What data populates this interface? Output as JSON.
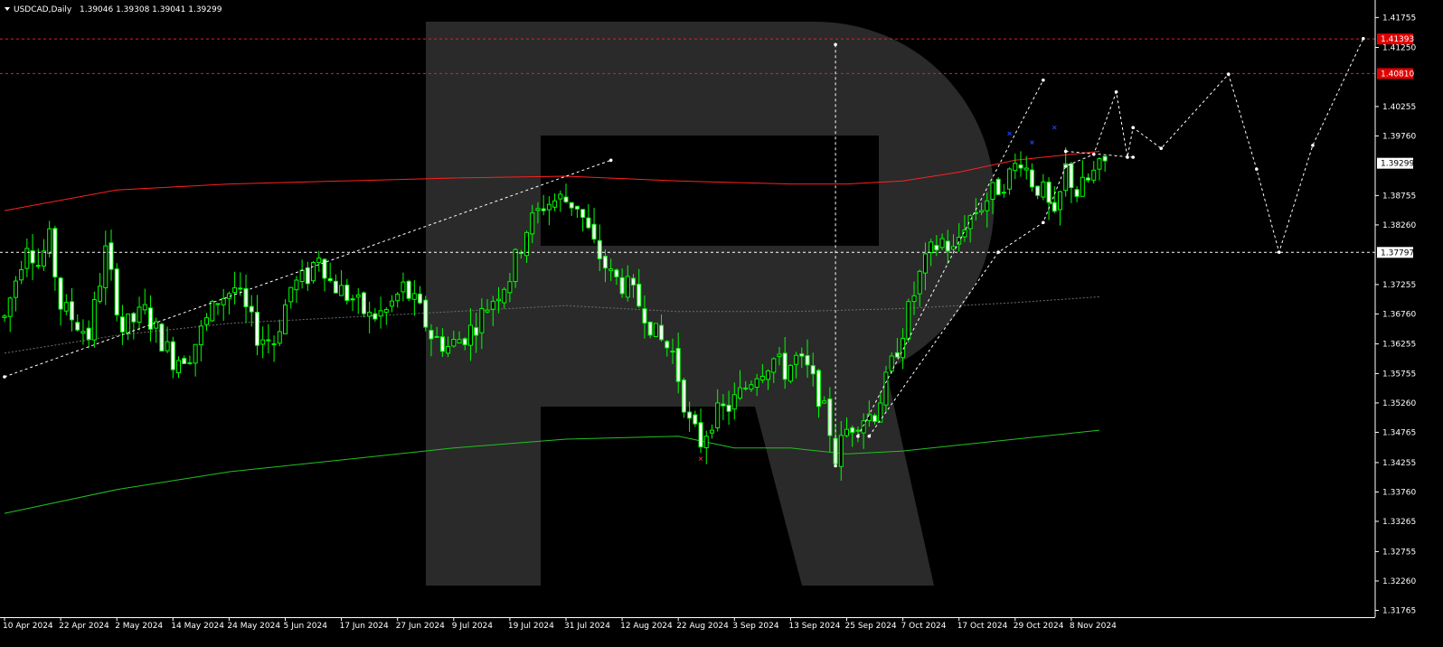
{
  "window": {
    "menu_icon": "triangle-down-icon",
    "symbol": "USDCAD,Daily",
    "ohlc": "1.39046 1.39308 1.39041 1.39299"
  },
  "colors": {
    "background": "#000000",
    "candle_up": "#00ff00",
    "candle_up_fill": "#000000",
    "candle_down": "#00ff00",
    "candle_down_fill": "#ffffff",
    "ma_red": "#ff2020",
    "ma_green": "#22c022",
    "ma_dotted": "#6e6e6e",
    "projection": "#ffffff",
    "level_line": "#e02020",
    "level_badge": "#e00000",
    "watermark": "#2a2a2a",
    "axis": "#ffffff"
  },
  "chart_data": {
    "type": "candlestick",
    "instrument": "USDCAD",
    "timeframe": "Daily",
    "ylim": [
      1.3165,
      1.4205
    ],
    "y_ticks": [
      "1.41755",
      "1.41250",
      "1.40255",
      "1.39760",
      "1.38755",
      "1.38260",
      "1.37255",
      "1.36760",
      "1.36255",
      "1.35755",
      "1.35260",
      "1.34765",
      "1.34255",
      "1.33760",
      "1.33265",
      "1.32755",
      "1.32260",
      "1.31765"
    ],
    "x_ticks": [
      "10 Apr 2024",
      "22 Apr 2024",
      "2 May 2024",
      "14 May 2024",
      "24 May 2024",
      "5 Jun 2024",
      "17 Jun 2024",
      "27 Jun 2024",
      "9 Jul 2024",
      "19 Jul 2024",
      "31 Jul 2024",
      "12 Aug 2024",
      "22 Aug 2024",
      "3 Sep 2024",
      "13 Sep 2024",
      "25 Sep 2024",
      "7 Oct 2024",
      "17 Oct 2024",
      "29 Oct 2024",
      "8 Nov 2024"
    ],
    "x_tick_bar_index": [
      0,
      10,
      20,
      30,
      40,
      50,
      60,
      70,
      80,
      90,
      100,
      110,
      120,
      130,
      140,
      150,
      160,
      170,
      180,
      190
    ],
    "bar_count": 197,
    "close_anchors": [
      [
        0,
        1.367
      ],
      [
        4,
        1.38
      ],
      [
        6,
        1.376
      ],
      [
        8,
        1.38
      ],
      [
        10,
        1.369
      ],
      [
        13,
        1.366
      ],
      [
        15,
        1.364
      ],
      [
        18,
        1.378
      ],
      [
        21,
        1.365
      ],
      [
        25,
        1.368
      ],
      [
        30,
        1.36
      ],
      [
        33,
        1.361
      ],
      [
        38,
        1.37
      ],
      [
        41,
        1.372
      ],
      [
        45,
        1.364
      ],
      [
        48,
        1.363
      ],
      [
        51,
        1.372
      ],
      [
        54,
        1.374
      ],
      [
        56,
        1.378
      ],
      [
        58,
        1.373
      ],
      [
        62,
        1.37
      ],
      [
        65,
        1.367
      ],
      [
        68,
        1.368
      ],
      [
        71,
        1.372
      ],
      [
        74,
        1.368
      ],
      [
        76,
        1.364
      ],
      [
        79,
        1.362
      ],
      [
        82,
        1.364
      ],
      [
        84,
        1.366
      ],
      [
        86,
        1.369
      ],
      [
        90,
        1.374
      ],
      [
        93,
        1.382
      ],
      [
        96,
        1.386
      ],
      [
        99,
        1.387
      ],
      [
        102,
        1.386
      ],
      [
        105,
        1.379
      ],
      [
        108,
        1.374
      ],
      [
        111,
        1.372
      ],
      [
        114,
        1.368
      ],
      [
        116,
        1.364
      ],
      [
        119,
        1.361
      ],
      [
        122,
        1.349
      ],
      [
        124,
        1.346
      ],
      [
        126,
        1.35
      ],
      [
        129,
        1.352
      ],
      [
        131,
        1.354
      ],
      [
        134,
        1.358
      ],
      [
        137,
        1.36
      ],
      [
        139,
        1.358
      ],
      [
        141,
        1.36
      ],
      [
        143,
        1.358
      ],
      [
        145,
        1.354
      ],
      [
        147,
        1.348
      ],
      [
        148,
        1.3435
      ],
      [
        150,
        1.348
      ],
      [
        152,
        1.35
      ],
      [
        155,
        1.351
      ],
      [
        157,
        1.356
      ],
      [
        159,
        1.362
      ],
      [
        161,
        1.368
      ],
      [
        163,
        1.374
      ],
      [
        165,
        1.378
      ],
      [
        167,
        1.38
      ],
      [
        169,
        1.378
      ],
      [
        171,
        1.383
      ],
      [
        173,
        1.385
      ],
      [
        175,
        1.387
      ],
      [
        177,
        1.389
      ],
      [
        179,
        1.391
      ],
      [
        181,
        1.394
      ],
      [
        183,
        1.39
      ],
      [
        185,
        1.388
      ],
      [
        187,
        1.383
      ],
      [
        189,
        1.392
      ],
      [
        191,
        1.388
      ],
      [
        193,
        1.39
      ],
      [
        194,
        1.3912
      ],
      [
        195,
        1.392
      ],
      [
        196,
        1.39299
      ]
    ],
    "moving_averages": [
      {
        "style": "solid",
        "color": "#ff2020",
        "points": [
          [
            0,
            1.385
          ],
          [
            20,
            1.3885
          ],
          [
            40,
            1.3895
          ],
          [
            60,
            1.39
          ],
          [
            80,
            1.3905
          ],
          [
            100,
            1.3908
          ],
          [
            120,
            1.39
          ],
          [
            140,
            1.3895
          ],
          [
            150,
            1.3895
          ],
          [
            160,
            1.39
          ],
          [
            170,
            1.3915
          ],
          [
            180,
            1.3935
          ],
          [
            195,
            1.395
          ]
        ]
      },
      {
        "style": "solid",
        "color": "#22c022",
        "points": [
          [
            0,
            1.334
          ],
          [
            20,
            1.338
          ],
          [
            40,
            1.341
          ],
          [
            60,
            1.343
          ],
          [
            80,
            1.345
          ],
          [
            100,
            1.3465
          ],
          [
            120,
            1.347
          ],
          [
            130,
            1.345
          ],
          [
            140,
            1.345
          ],
          [
            150,
            1.344
          ],
          [
            160,
            1.3445
          ],
          [
            170,
            1.3455
          ],
          [
            180,
            1.3465
          ],
          [
            190,
            1.3475
          ],
          [
            195,
            1.348
          ]
        ]
      },
      {
        "style": "dotted",
        "color": "#6e6e6e",
        "points": [
          [
            0,
            1.361
          ],
          [
            20,
            1.364
          ],
          [
            40,
            1.366
          ],
          [
            60,
            1.367
          ],
          [
            80,
            1.368
          ],
          [
            100,
            1.369
          ],
          [
            120,
            1.368
          ],
          [
            140,
            1.368
          ],
          [
            160,
            1.3685
          ],
          [
            180,
            1.3695
          ],
          [
            195,
            1.3705
          ]
        ]
      }
    ],
    "horizontal_levels": [
      {
        "value": 1.41393,
        "label": "1.41393",
        "style": "dashed",
        "color": "#e02020"
      },
      {
        "value": 1.4081,
        "label": "1.40810",
        "style": "dashed",
        "color": "#e02020"
      },
      {
        "value": 1.37797,
        "label": "1.37797",
        "style": "dashed",
        "color": "#ffffff"
      }
    ],
    "current_price_label": "1.39299",
    "projection_lines": [
      {
        "points": [
          [
            0,
            1.357
          ],
          [
            108,
            1.3935
          ]
        ]
      },
      {
        "points": [
          [
            152,
            1.347
          ],
          [
            185,
            1.407
          ]
        ]
      },
      {
        "points": [
          [
            148,
            1.413
          ],
          [
            148,
            1.342
          ]
        ]
      },
      {
        "points": [
          [
            154,
            1.347
          ],
          [
            177,
            1.378
          ],
          [
            185,
            1.383
          ],
          [
            189,
            1.3925
          ],
          [
            194,
            1.3945
          ],
          [
            198,
            1.405
          ],
          [
            200,
            1.394
          ],
          [
            201,
            1.399
          ],
          [
            206,
            1.3955
          ],
          [
            218,
            1.408
          ],
          [
            223,
            1.392
          ],
          [
            227,
            1.378
          ],
          [
            233,
            1.396
          ],
          [
            242,
            1.414
          ]
        ]
      },
      {
        "points": [
          [
            189,
            1.395
          ],
          [
            201,
            1.394
          ]
        ]
      }
    ],
    "markers": [
      {
        "bar": 124,
        "value": 1.3432,
        "color": "#e02020",
        "symbol": "x"
      },
      {
        "bar": 179,
        "value": 1.398,
        "color": "#2040ff",
        "symbol": "x"
      },
      {
        "bar": 183,
        "value": 1.3965,
        "color": "#2040ff",
        "symbol": "x"
      },
      {
        "bar": 187,
        "value": 1.399,
        "color": "#2040ff",
        "symbol": "x"
      }
    ]
  }
}
